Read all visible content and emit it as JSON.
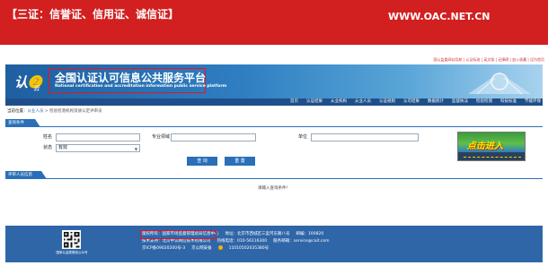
{
  "banner": {
    "left_text": "【三证：信誉证、信用证、诚信证】",
    "right_text": "WWW.OAC.NET.CN"
  },
  "top_links": {
    "text": "国认监委网站导航 | 认证标准 | 英文版 | 无障碍 | 加入收藏 | 设为首页"
  },
  "header": {
    "logo_text": "认",
    "logo_sub": "云",
    "title_main": "全国认证认可信息公共服务平台",
    "title_sub": "National certification and accreditation information public service platform"
  },
  "nav": {
    "items": [
      "首页",
      "认证结果",
      "从业机构",
      "从业人员",
      "认证规则",
      "认可结果",
      "数据统计",
      "监督执法",
      "检验检测",
      "科技标准",
      "节能环保"
    ]
  },
  "breadcrumb": {
    "prefix": "当前位置：",
    "link": "从业人员",
    "separator": " > ",
    "current": "检验检测机构资质认定评审员"
  },
  "search_panel": {
    "tab_label": "查询条件",
    "fields": {
      "name_label": "姓名",
      "name_value": "",
      "major_label": "专业领域",
      "major_value": "",
      "unit_label": "单位",
      "unit_value": "",
      "status_label": "状态",
      "status_value": "有效"
    },
    "buttons": {
      "search": "查 询",
      "reset": "重 置"
    }
  },
  "promo": {
    "text": "点击进入"
  },
  "results": {
    "tab_label": "评审人员信息",
    "empty_message": "请输入查询条件！"
  },
  "footer": {
    "qr_caption": "国家认监委微信公众号",
    "line1": [
      "版权所有：国家市场监督管理总局信息中心",
      "地址：北京市西城区三里河东路八号",
      "邮编：100820"
    ],
    "line2": [
      "技术支持：北京中认网信技术有限公司",
      "热线电话：010-56116300",
      "服务邮箱：service@cait.com"
    ],
    "line3": [
      "京ICP备09020200号-3",
      "京公网安备",
      "11010502035380号"
    ]
  },
  "colors": {
    "banner_red": "#d21f1f",
    "nav_blue": "#1f4f8a",
    "accent_blue": "#2a6fb8",
    "highlight_red": "#e11122"
  }
}
